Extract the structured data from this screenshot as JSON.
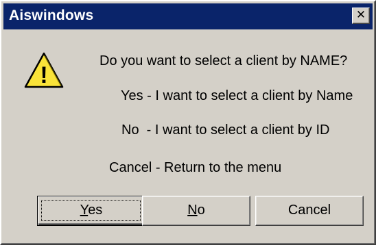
{
  "window": {
    "title": "Aiswindows",
    "close_glyph": "✕",
    "close_icon": "close-icon"
  },
  "icon": {
    "name": "warning-icon",
    "glyph": "!",
    "fill_color": "#f9e339",
    "outline_color": "#000000"
  },
  "message": {
    "question": "Do you want to select a client by NAME?",
    "yes_line": "Yes - I want to select a client by Name",
    "no_line": "No  - I want to select a client by ID",
    "cancel_line": "Cancel - Return to the menu"
  },
  "buttons": {
    "yes": {
      "mnemonic": "Y",
      "rest": "es"
    },
    "no": {
      "mnemonic": "N",
      "rest": "o"
    },
    "cancel": {
      "label": "Cancel"
    }
  },
  "colors": {
    "titlebar": "#0a246a",
    "dialog_bg": "#d4d0c8"
  }
}
